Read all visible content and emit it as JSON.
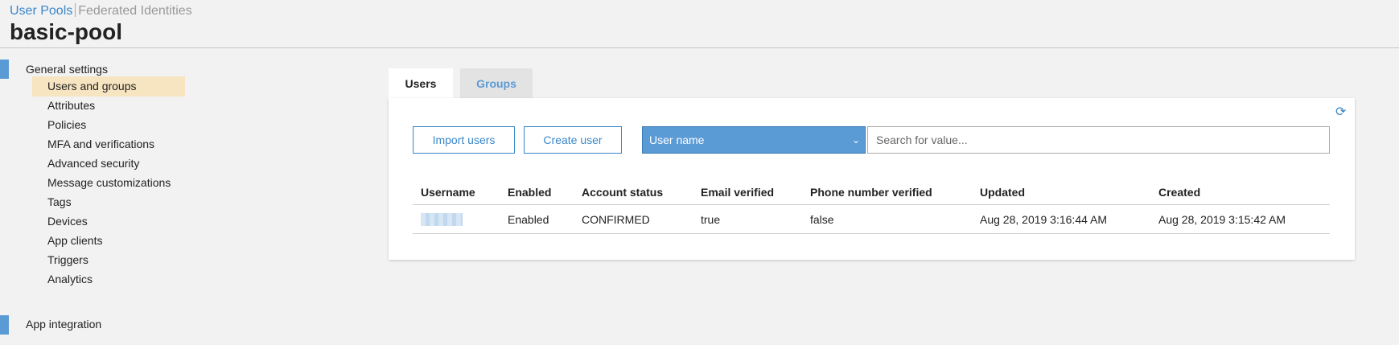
{
  "breadcrumb": {
    "active": "User Pools",
    "inactive": "Federated Identities"
  },
  "pool_title": "basic-pool",
  "sidebar": {
    "general_settings": "General settings",
    "items": [
      {
        "label": "Users and groups",
        "active": true
      },
      {
        "label": "Attributes"
      },
      {
        "label": "Policies"
      },
      {
        "label": "MFA and verifications"
      },
      {
        "label": "Advanced security"
      },
      {
        "label": "Message customizations"
      },
      {
        "label": "Tags"
      },
      {
        "label": "Devices"
      },
      {
        "label": "App clients"
      },
      {
        "label": "Triggers"
      },
      {
        "label": "Analytics"
      }
    ],
    "app_integration": "App integration"
  },
  "tabs": {
    "users": "Users",
    "groups": "Groups"
  },
  "toolbar": {
    "import_label": "Import users",
    "create_label": "Create user",
    "select_value": "User name",
    "search_placeholder": "Search for value..."
  },
  "table": {
    "headers": [
      "Username",
      "Enabled",
      "Account status",
      "Email verified",
      "Phone number verified",
      "Updated",
      "Created"
    ],
    "rows": [
      {
        "enabled": "Enabled",
        "status": "CONFIRMED",
        "email_verified": "true",
        "phone_verified": "false",
        "updated": "Aug 28, 2019 3:16:44 AM",
        "created": "Aug 28, 2019 3:15:42 AM"
      }
    ]
  },
  "colors": {
    "accent": "#3a87c8",
    "selected_bg": "#f7e4c0",
    "select_bg": "#5b9bd5"
  }
}
